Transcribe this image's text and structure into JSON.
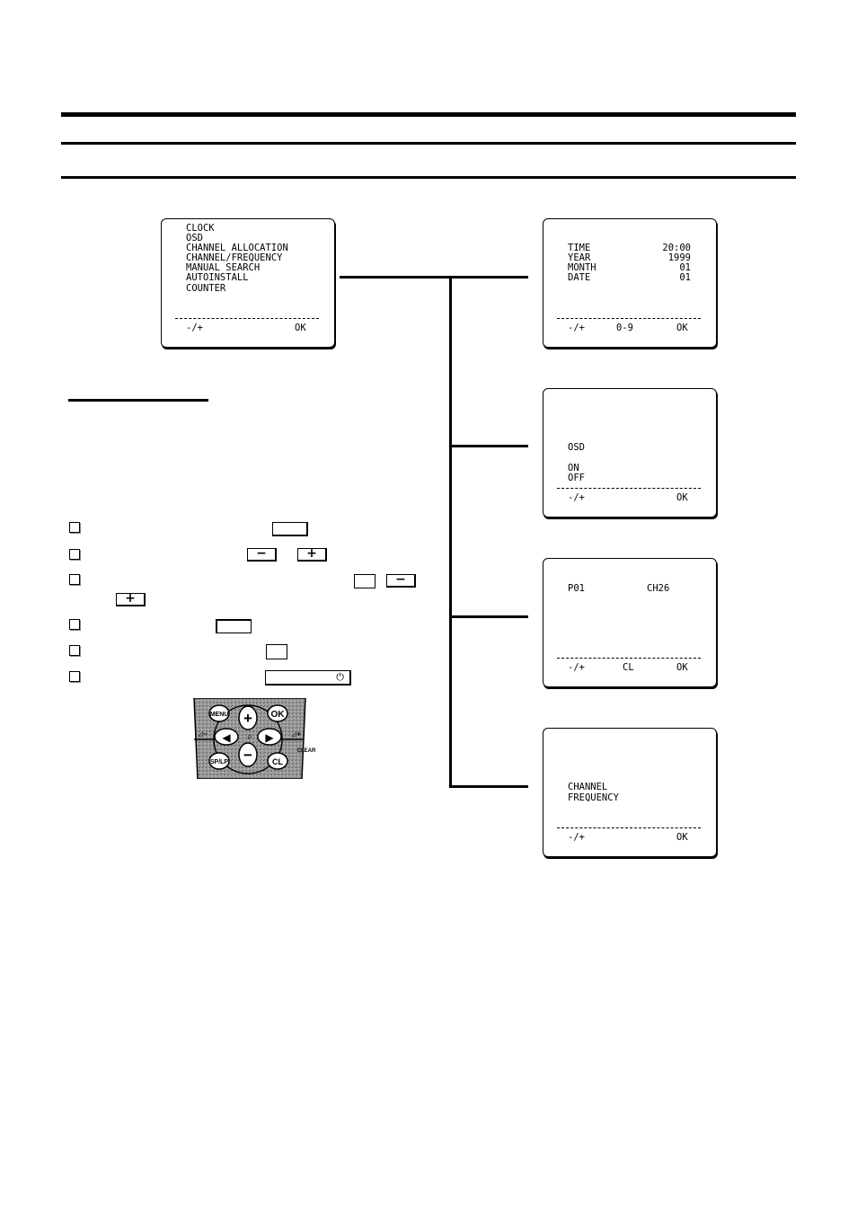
{
  "main_menu": {
    "items": [
      "CLOCK",
      "OSD",
      "CHANNEL ALLOCATION",
      "CHANNEL/FREQUENCY",
      "MANUAL SEARCH",
      "AUTOINSTALL",
      "COUNTER"
    ],
    "footer_left": "-/+",
    "footer_right": "OK"
  },
  "clock_screen": {
    "rows": [
      {
        "label": "TIME",
        "value": "20:00"
      },
      {
        "label": "YEAR",
        "value": "1999"
      },
      {
        "label": "MONTH",
        "value": "01"
      },
      {
        "label": "DATE",
        "value": "01"
      }
    ],
    "footer_left": "-/+",
    "footer_mid": "0-9",
    "footer_right": "OK"
  },
  "osd_screen": {
    "title": "OSD",
    "options": [
      "ON",
      "OFF"
    ],
    "footer_left": "-/+",
    "footer_right": "OK"
  },
  "channel_allocation_screen": {
    "program": "P01",
    "channel": "CH26",
    "footer_left": "-/+",
    "footer_mid": "CL",
    "footer_right": "OK"
  },
  "channel_frequency_screen": {
    "options": [
      "CHANNEL",
      "FREQUENCY"
    ],
    "footer_left": "-/+",
    "footer_right": "OK"
  },
  "keys": {
    "minus": "−",
    "plus": "+",
    "power": "⏻"
  },
  "remote": {
    "menu": "MENU",
    "ok": "OK",
    "sp_lp": "SP/LP",
    "cl": "CL",
    "clear": "CLEAR",
    "plus": "+",
    "minus": "−",
    "left": "◀",
    "right": "▶",
    "p": "P",
    "vol_minus": "◿−",
    "vol_plus": "◿+"
  }
}
